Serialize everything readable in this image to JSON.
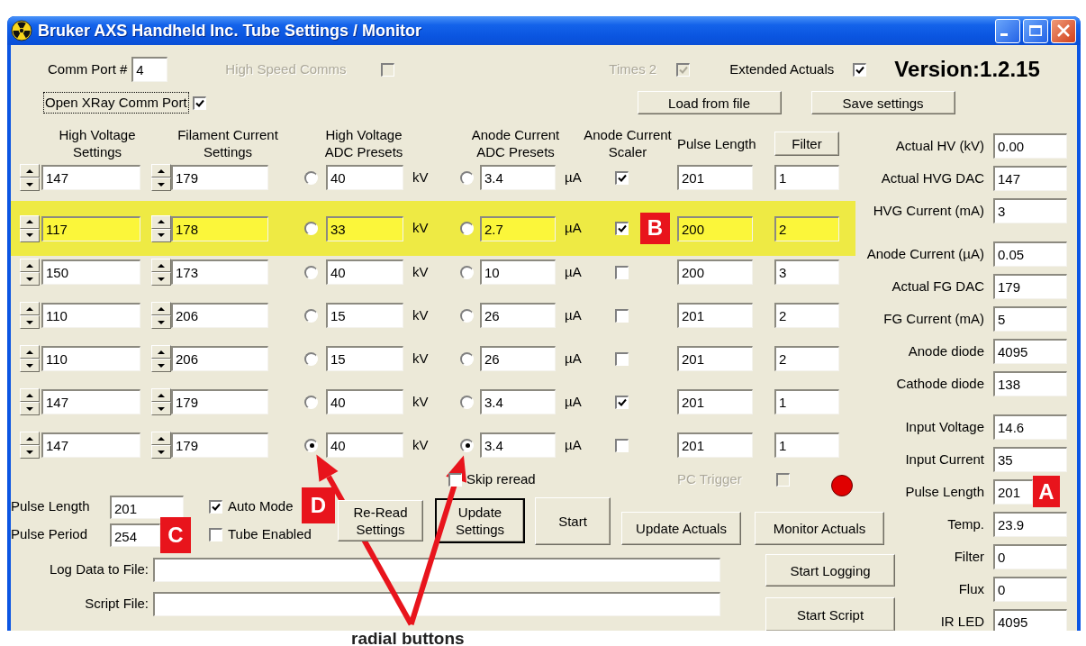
{
  "window": {
    "title": "Bruker AXS Handheld Inc. Tube Settings / Monitor"
  },
  "top": {
    "comm_port": {
      "label": "Comm Port #",
      "value": "4"
    },
    "options": [
      {
        "label": "High Speed Comms",
        "checked": false,
        "disabled": true
      },
      {
        "label": "Times 2",
        "checked": true,
        "disabled": true
      },
      {
        "label": "Extended Actuals",
        "checked": true,
        "disabled": false
      }
    ],
    "version": "Version:1.2.15",
    "open_port": {
      "label": "Open XRay Comm Port",
      "checked": true,
      "focused": true
    },
    "buttons": [
      "Load from file",
      "Save settings"
    ]
  },
  "presets": {
    "headers": [
      "High Voltage Settings",
      "Filament Current Settings",
      "High Voltage ADC Presets",
      "Anode Current ADC Presets",
      "Anode Current Scaler",
      "Pulse Length"
    ],
    "filter_button": "Filter",
    "rows": [
      {
        "high_voltage": "147",
        "filament_current": "179",
        "hv_preset": {
          "value": "40",
          "unit": "kV",
          "selected": false
        },
        "anode_preset": {
          "value": "3.4",
          "unit": "µA",
          "selected": false
        },
        "scaler_checked": true,
        "pulse_length": "201",
        "filter": "1",
        "highlighted": false
      },
      {
        "high_voltage": "117",
        "filament_current": "178",
        "hv_preset": {
          "value": "33",
          "unit": "kV",
          "selected": false
        },
        "anode_preset": {
          "value": "2.7",
          "unit": "µA",
          "selected": false
        },
        "scaler_checked": true,
        "pulse_length": "200",
        "filter": "2",
        "highlighted": true,
        "callout": "B"
      },
      {
        "high_voltage": "150",
        "filament_current": "173",
        "hv_preset": {
          "value": "40",
          "unit": "kV",
          "selected": false
        },
        "anode_preset": {
          "value": "10",
          "unit": "µA",
          "selected": false
        },
        "scaler_checked": false,
        "pulse_length": "200",
        "filter": "3",
        "highlighted": false
      },
      {
        "high_voltage": "110",
        "filament_current": "206",
        "hv_preset": {
          "value": "15",
          "unit": "kV",
          "selected": false
        },
        "anode_preset": {
          "value": "26",
          "unit": "µA",
          "selected": false
        },
        "scaler_checked": false,
        "pulse_length": "201",
        "filter": "2",
        "highlighted": false
      },
      {
        "high_voltage": "110",
        "filament_current": "206",
        "hv_preset": {
          "value": "15",
          "unit": "kV",
          "selected": false
        },
        "anode_preset": {
          "value": "26",
          "unit": "µA",
          "selected": false
        },
        "scaler_checked": false,
        "pulse_length": "201",
        "filter": "2",
        "highlighted": false
      },
      {
        "high_voltage": "147",
        "filament_current": "179",
        "hv_preset": {
          "value": "40",
          "unit": "kV",
          "selected": false
        },
        "anode_preset": {
          "value": "3.4",
          "unit": "µA",
          "selected": false
        },
        "scaler_checked": true,
        "pulse_length": "201",
        "filter": "1",
        "highlighted": false
      },
      {
        "high_voltage": "147",
        "filament_current": "179",
        "hv_preset": {
          "value": "40",
          "unit": "kV",
          "selected": true
        },
        "anode_preset": {
          "value": "3.4",
          "unit": "µA",
          "selected": true
        },
        "scaler_checked": false,
        "pulse_length": "201",
        "filter": "1",
        "highlighted": false
      }
    ]
  },
  "actuals": [
    [
      {
        "label": "Actual HV (kV)",
        "value": "0.00"
      },
      {
        "label": "Actual HVG DAC",
        "value": "147"
      },
      {
        "label": "HVG Current (mA)",
        "value": "3"
      }
    ],
    [
      {
        "label": "Anode Current (µA)",
        "value": "0.05"
      },
      {
        "label": "Actual FG DAC",
        "value": "179"
      },
      {
        "label": "FG Current (mA)",
        "value": "5"
      },
      {
        "label": "Anode diode",
        "value": "4095"
      },
      {
        "label": "Cathode diode",
        "value": "138"
      }
    ],
    [
      {
        "label": "Input Voltage",
        "value": "14.6"
      },
      {
        "label": "Input Current",
        "value": "35"
      },
      {
        "label": "Pulse Length",
        "value": "201",
        "callout": "A"
      },
      {
        "label": "Temp.",
        "value": "23.9"
      },
      {
        "label": "Filter",
        "value": "0"
      },
      {
        "label": "Flux",
        "value": "0"
      },
      {
        "label": "IR LED",
        "value": "4095"
      }
    ]
  ],
  "bottom": {
    "skip_reread": {
      "label": "Skip reread",
      "checked": false
    },
    "pc_trigger": {
      "label": "PC Trigger",
      "checked": false,
      "disabled": true
    },
    "status_light": {
      "on": true
    },
    "pulse_length": {
      "label": "Pulse Length",
      "value": "201"
    },
    "pulse_period": {
      "label": "Pulse Period",
      "value": "254",
      "callout": "C"
    },
    "auto_mode": {
      "label": "Auto Mode",
      "checked": true,
      "callout": "D"
    },
    "tube_enabled": {
      "label": "Tube Enabled",
      "checked": false
    },
    "buttons": [
      {
        "label": "Re-Read Settings",
        "default": false
      },
      {
        "label": "Update Settings",
        "default": true
      },
      {
        "label": "Start",
        "default": false
      },
      {
        "label": "Update Actuals",
        "default": false
      },
      {
        "label": "Monitor Actuals",
        "default": false
      }
    ],
    "log_file": {
      "label": "Log Data to File:"
    },
    "script_file": {
      "label": "Script File:"
    },
    "side_buttons": [
      "Start Logging",
      "Start Script"
    ]
  },
  "annotation": {
    "caption": "radial buttons"
  }
}
